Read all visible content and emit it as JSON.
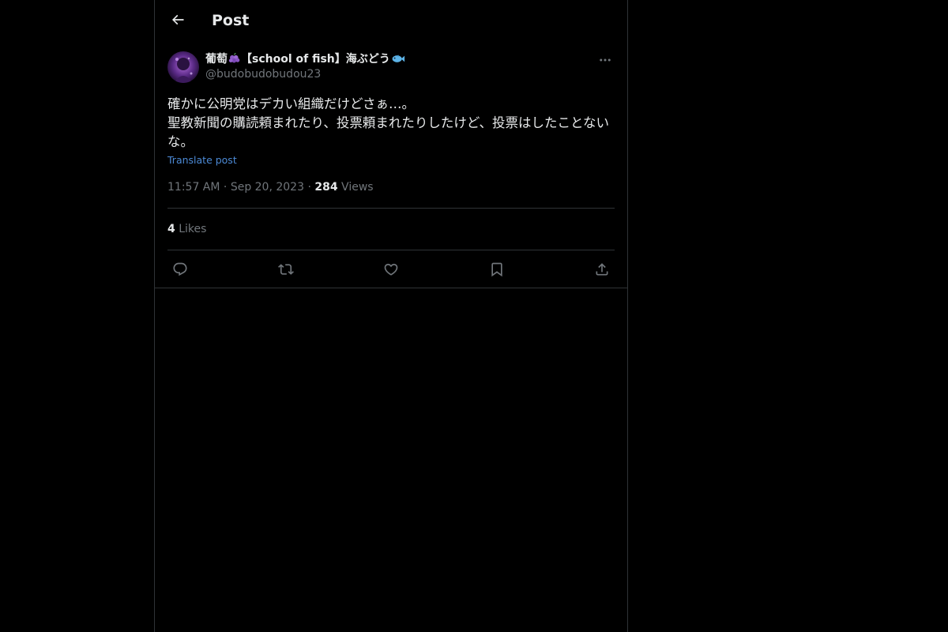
{
  "header": {
    "title": "Post",
    "back_icon": "arrow-left-icon"
  },
  "post": {
    "author": {
      "display_name": "葡萄🍇【school of fish】海ぶどう🐟",
      "display_name_prefix": "葡萄",
      "display_name_middle": "【school of fish】海ぶどう",
      "handle": "@budobudobudou23"
    },
    "text": "確かに公明党はデカい組織だけどさぁ…。\n聖教新聞の購読頼まれたり、投票頼まれたりしたけど、投票はしたことないな。",
    "translate_label": "Translate post",
    "time": "11:57 AM",
    "date": "Sep 20, 2023",
    "views_count": "284",
    "views_label": "Views",
    "likes_count": "4",
    "likes_label": "Likes"
  },
  "actions": [
    {
      "icon": "reply-icon"
    },
    {
      "icon": "repost-icon"
    },
    {
      "icon": "like-icon"
    },
    {
      "icon": "bookmark-icon"
    },
    {
      "icon": "share-icon"
    }
  ],
  "colors": {
    "background": "#000000",
    "text": "#e7e9ea",
    "secondary_text": "#71767b",
    "link": "#4c8ad6",
    "border": "#2f3336"
  }
}
